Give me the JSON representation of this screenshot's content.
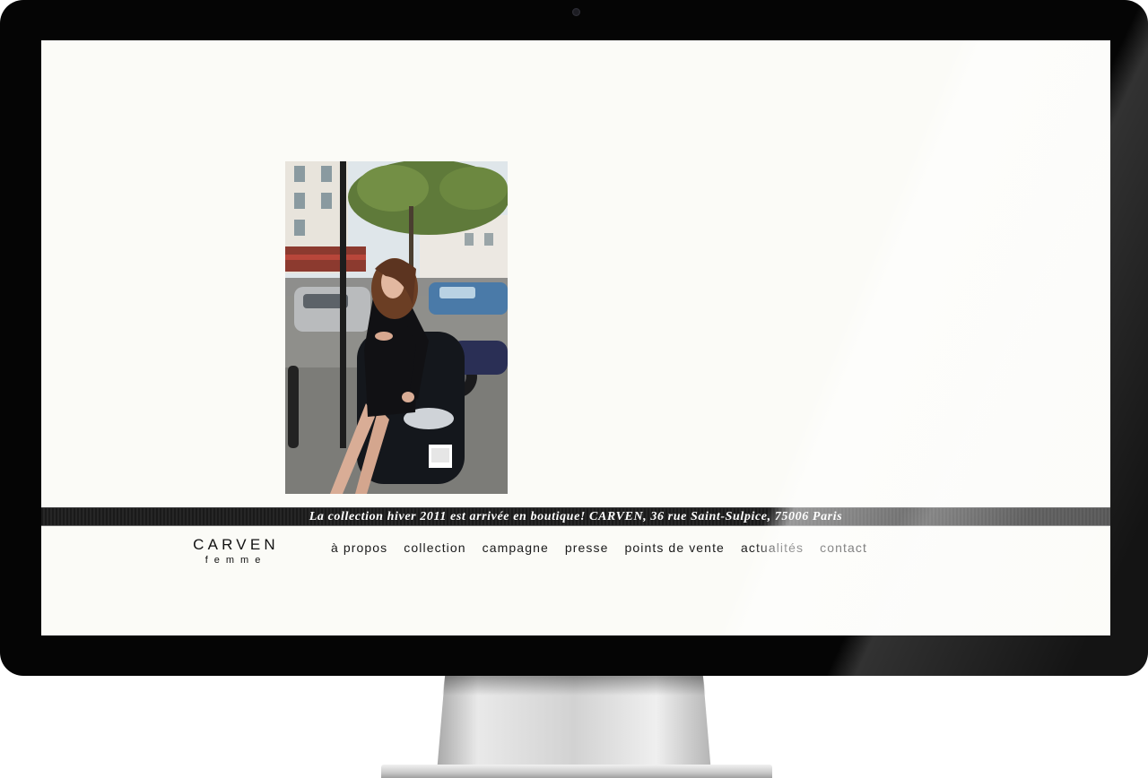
{
  "ticker": {
    "text": "La collection hiver 2011 est arrivée en boutique! CARVEN, 36 rue Saint-Sulpice, 75006 Paris"
  },
  "logo": {
    "brand": "CARVEN",
    "line": "femme"
  },
  "nav": {
    "items": [
      {
        "label": "à propos"
      },
      {
        "label": "collection"
      },
      {
        "label": "campagne"
      },
      {
        "label": "presse"
      },
      {
        "label": "points de vente"
      },
      {
        "label": "actualités"
      },
      {
        "label": "contact"
      }
    ]
  },
  "colors": {
    "page_background": "#fbfbf7",
    "ticker_background": "#1a1a1a",
    "ticker_text": "#ffffff",
    "nav_text": "#1a1a1a",
    "bezel": "#050505"
  }
}
